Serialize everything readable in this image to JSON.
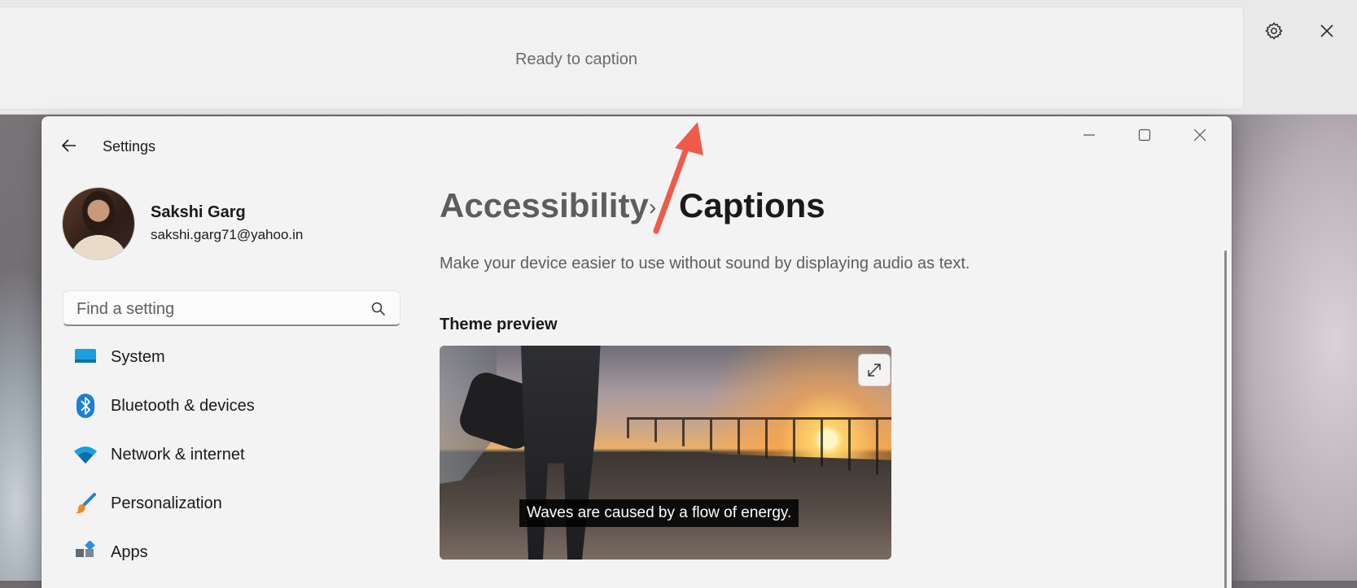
{
  "live_captions": {
    "status_text": "Ready to caption",
    "settings_icon": "gear-icon",
    "close_icon": "close-icon"
  },
  "settings_window": {
    "title": "Settings",
    "controls": {
      "minimize": "minimize-icon",
      "maximize": "maximize-icon",
      "close": "close-icon"
    },
    "user": {
      "name": "Sakshi Garg",
      "email": "sakshi.garg71@yahoo.in"
    },
    "search": {
      "placeholder": "Find a setting"
    },
    "nav_items": [
      {
        "label": "System",
        "icon": "monitor-icon"
      },
      {
        "label": "Bluetooth & devices",
        "icon": "bluetooth-icon"
      },
      {
        "label": "Network & internet",
        "icon": "wifi-icon"
      },
      {
        "label": "Personalization",
        "icon": "paintbrush-icon"
      },
      {
        "label": "Apps",
        "icon": "apps-icon"
      }
    ],
    "breadcrumb": {
      "parent": "Accessibility",
      "separator": "›",
      "current": "Captions"
    },
    "description": "Make your device easier to use without sound by displaying audio as text.",
    "theme_preview": {
      "section_title": "Theme preview",
      "caption_sample": "Waves are caused by a flow of energy.",
      "expand_icon": "expand-icon"
    }
  },
  "colors": {
    "annotation_arrow": "#ef5a4a",
    "caption_bg": "#000000",
    "window_bg": "#f3f3f3"
  }
}
